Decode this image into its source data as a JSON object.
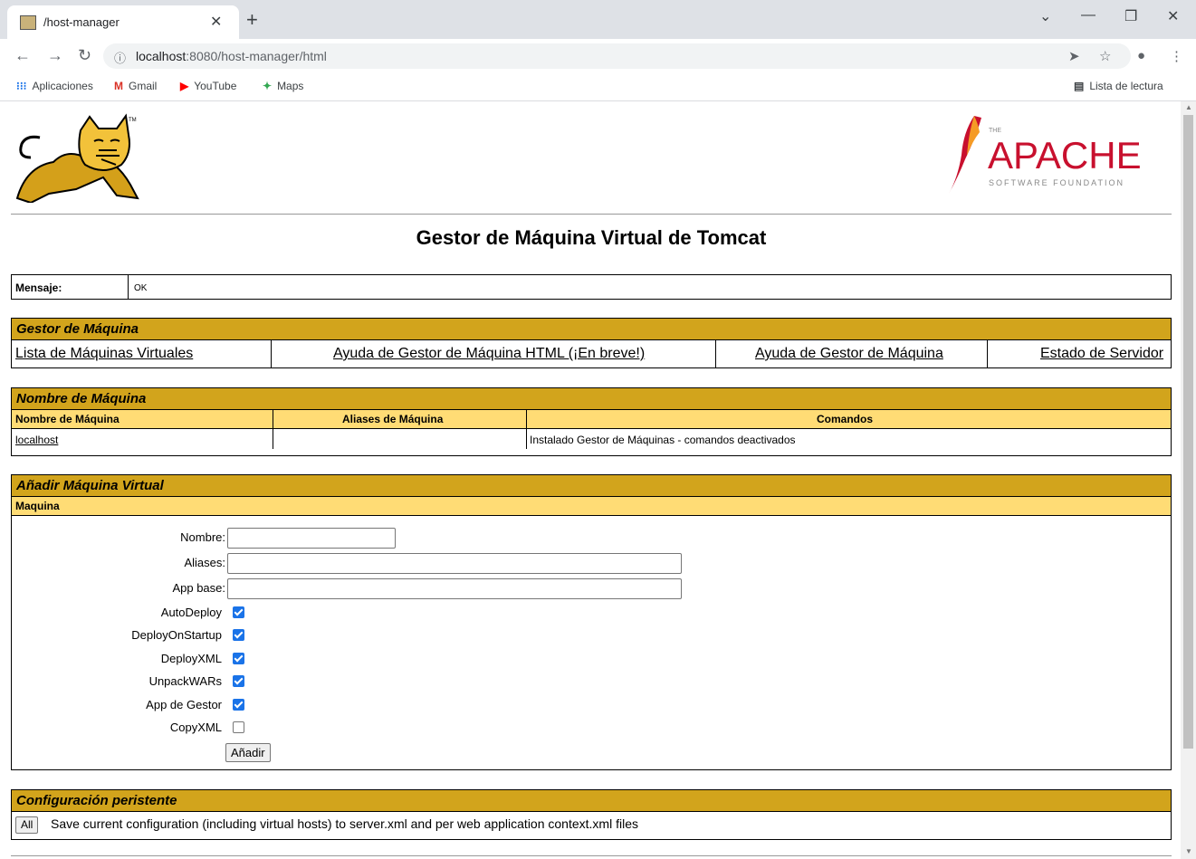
{
  "browser": {
    "tab_title": "/host-manager",
    "url_host": "localhost",
    "url_path": ":8080/host-manager/html",
    "bookmarks": [
      "Aplicaciones",
      "Gmail",
      "YouTube",
      "Maps"
    ],
    "reading_list": "Lista de lectura"
  },
  "page": {
    "title": "Gestor de Máquina Virtual de Tomcat",
    "logo_tm": "TM",
    "apache": {
      "the": "THE",
      "name": "APACHE",
      "sub": "SOFTWARE FOUNDATION"
    },
    "message": {
      "label": "Mensaje:",
      "value": "OK"
    },
    "host_manager": {
      "header": "Gestor de Máquina",
      "links": [
        "Lista de Máquinas Virtuales",
        "Ayuda de Gestor de Máquina HTML (¡En breve!)",
        "Ayuda de Gestor de Máquina",
        "Estado de Servidor"
      ]
    },
    "host_list": {
      "header": "Nombre de Máquina",
      "columns": [
        "Nombre de Máquina",
        "Aliases de Máquina",
        "Comandos"
      ],
      "rows": [
        {
          "name": "localhost",
          "aliases": "",
          "commands": "Instalado Gestor de Máquinas - comandos deactivados"
        }
      ]
    },
    "add_host": {
      "header": "Añadir Máquina Virtual",
      "subheader": "Maquina",
      "fields": {
        "name": "Nombre:",
        "aliases": "Aliases:",
        "appbase": "App base:"
      },
      "options": [
        {
          "label": "AutoDeploy",
          "checked": true
        },
        {
          "label": "DeployOnStartup",
          "checked": true
        },
        {
          "label": "DeployXML",
          "checked": true
        },
        {
          "label": "UnpackWARs",
          "checked": true
        },
        {
          "label": "App de Gestor",
          "checked": true
        },
        {
          "label": "CopyXML",
          "checked": false
        }
      ],
      "submit": "Añadir"
    },
    "persist": {
      "header": "Configuración peristente",
      "button": "All",
      "text": "Save current configuration (including virtual hosts) to server.xml and per web application context.xml files"
    }
  }
}
